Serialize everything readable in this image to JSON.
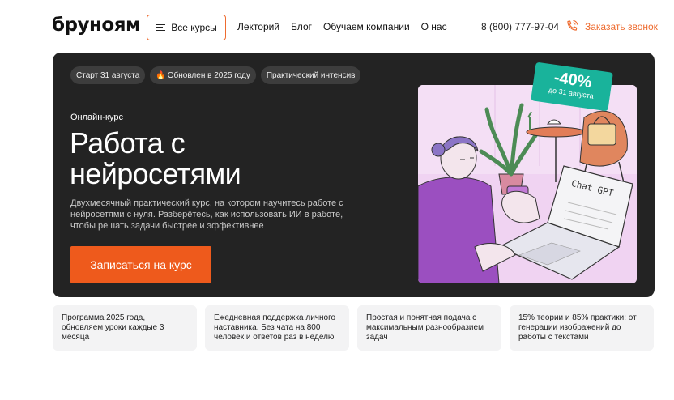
{
  "header": {
    "logo": "бруноям",
    "courses_button": "Все курсы",
    "nav": [
      "Лекторий",
      "Блог",
      "Обучаем компании",
      "О нас"
    ],
    "phone": "8 (800) 777-97-04",
    "callback": "Заказать звонок"
  },
  "hero": {
    "badges": [
      "Старт 31 августа",
      "Обновлен в 2025 году",
      "Практический интенсив"
    ],
    "kicker": "Онлайн-курс",
    "title_line1": "Работа с",
    "title_line2": "нейросетями",
    "description": "Двухмесячный практический курс, на котором научитесь работе с нейросетями с нуля. Разберётесь, как использовать ИИ в работе, чтобы решать задачи быстрее и эффективнее",
    "cta": "Записаться на курс",
    "discount": {
      "percent": "-40%",
      "until": "до 31 августа"
    },
    "laptop_text": "Chat GPT"
  },
  "features": [
    "Программа 2025 года, обновляем уроки каждые 3 месяца",
    "Ежедневная поддержка личного наставника. Без чата на 800 человек и ответов раз в неделю",
    "Простая и понятная подача с максимальным разнообразием задач",
    "15% теории и 85% практики: от генерации изображений до работы с текстами"
  ],
  "colors": {
    "accent": "#ee5a1c",
    "hero_bg": "#232323",
    "discount_bg": "#19b39b",
    "card_bg": "#f3f3f4"
  }
}
